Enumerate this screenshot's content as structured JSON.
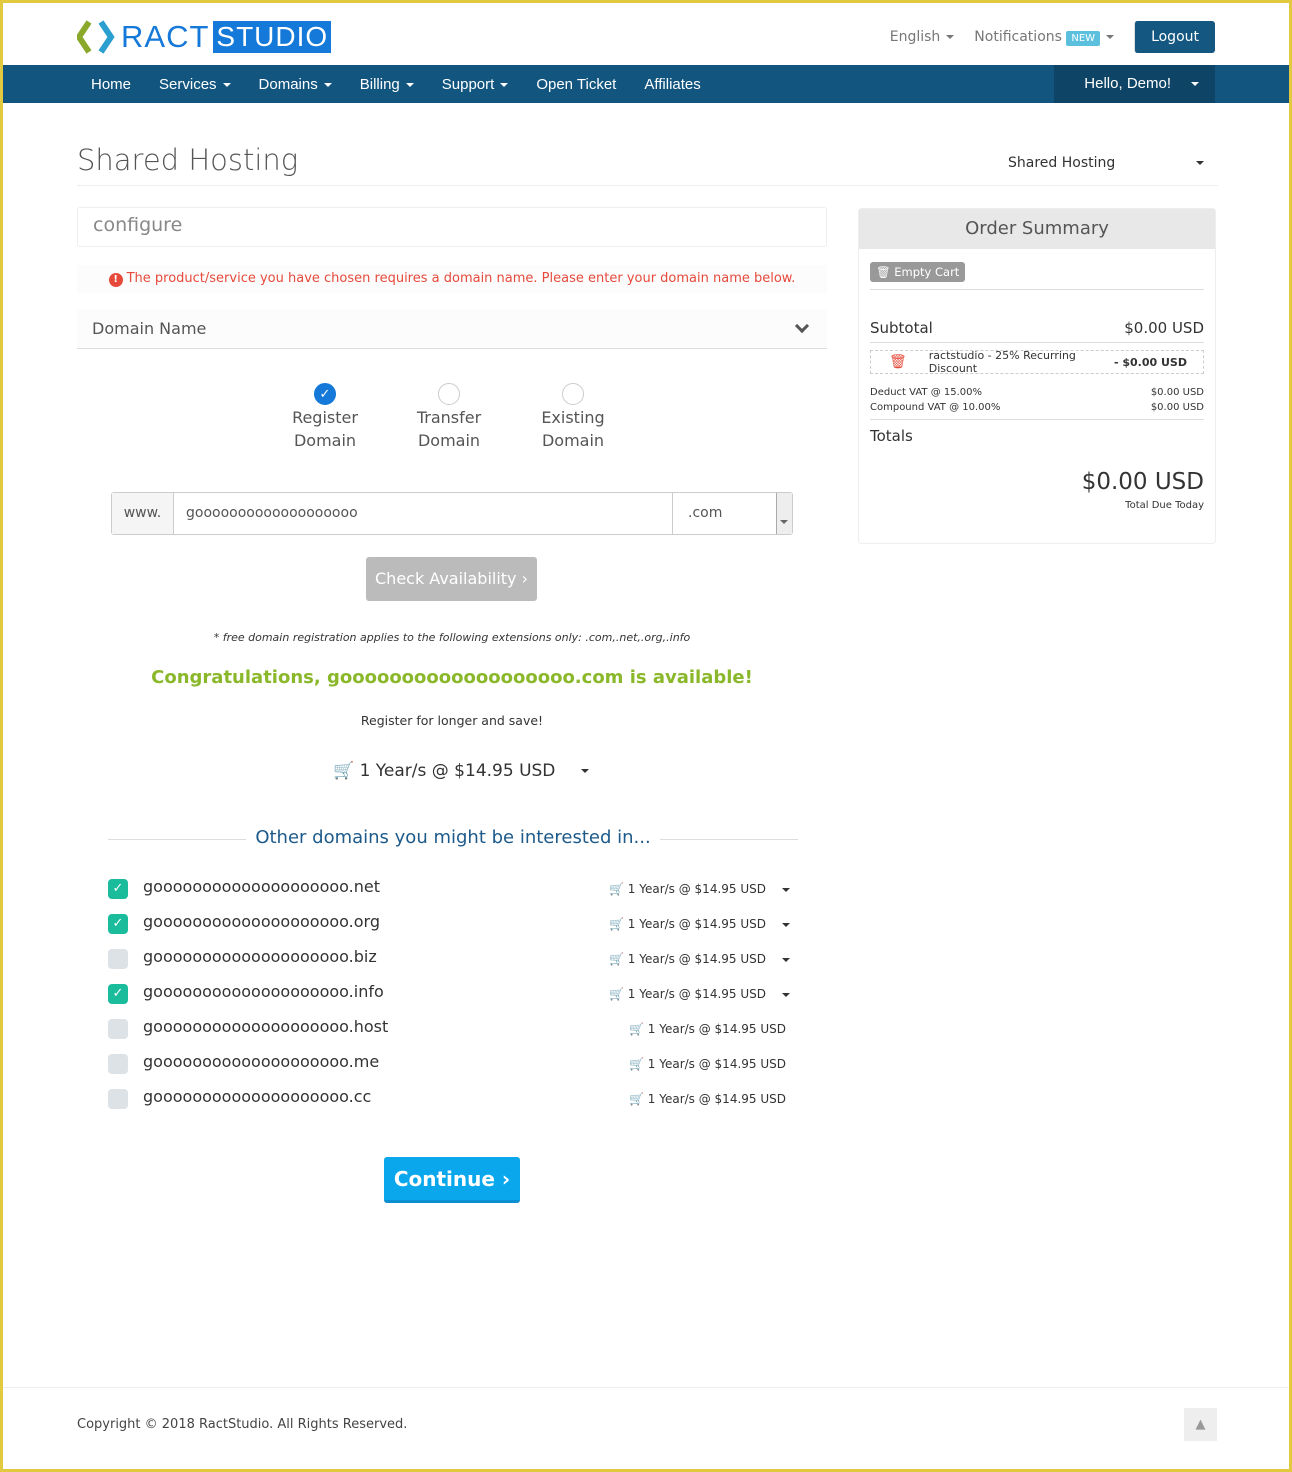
{
  "brand": {
    "part1": "RACT",
    "part2": "STUDIO",
    "accent": "#1479d8"
  },
  "topbar": {
    "language": "English",
    "notifications": "Notifications",
    "new_badge": "NEW",
    "logout": "Logout"
  },
  "nav": {
    "items": [
      "Home",
      "Services",
      "Domains",
      "Billing",
      "Support",
      "Open Ticket",
      "Affiliates"
    ],
    "user": "Hello, Demo!"
  },
  "page": {
    "title": "Shared Hosting",
    "category_select": "Shared Hosting"
  },
  "configure": {
    "heading": "configure",
    "alert": "The product/service you have chosen requires a domain name. Please enter your domain name below.",
    "domain_name_label": "Domain Name",
    "options": [
      {
        "label1": "Register",
        "label2": "Domain",
        "selected": true
      },
      {
        "label1": "Transfer",
        "label2": "Domain",
        "selected": false
      },
      {
        "label1": "Existing",
        "label2": "Domain",
        "selected": false
      }
    ],
    "www": "www.",
    "domain_input": "gooooooooooooooooooo",
    "tld": ".com",
    "check_button": "Check Availability",
    "free_note": "* free domain registration applies to the following extensions only: .com,.net,.org,.info",
    "available": "Congratulations, gooooooooooooooooooo.com is available!",
    "register_longer": "Register for longer and save!",
    "period": "1 Year/s @ $14.95 USD",
    "other_heading": "Other domains you might be interested in...",
    "suggestions": [
      {
        "name": "goooooooooooooooooooo.net",
        "price": "1 Year/s @ $14.95 USD",
        "checked": true,
        "dropdown": true
      },
      {
        "name": "goooooooooooooooooooo.org",
        "price": "1 Year/s @ $14.95 USD",
        "checked": true,
        "dropdown": true
      },
      {
        "name": "goooooooooooooooooooo.biz",
        "price": "1 Year/s @ $14.95 USD",
        "checked": false,
        "dropdown": true
      },
      {
        "name": "goooooooooooooooooooo.info",
        "price": "1 Year/s @ $14.95 USD",
        "checked": true,
        "dropdown": true
      },
      {
        "name": "goooooooooooooooooooo.host",
        "price": "1 Year/s @ $14.95 USD",
        "checked": false,
        "dropdown": false
      },
      {
        "name": "goooooooooooooooooooo.me",
        "price": "1 Year/s @ $14.95 USD",
        "checked": false,
        "dropdown": false
      },
      {
        "name": "goooooooooooooooooooo.cc",
        "price": "1 Year/s @ $14.95 USD",
        "checked": false,
        "dropdown": false
      }
    ],
    "continue": "Continue"
  },
  "summary": {
    "heading": "Order Summary",
    "empty_cart": "Empty Cart",
    "subtotal_label": "Subtotal",
    "subtotal": "$0.00 USD",
    "discount_label": "ractstudio - 25% Recurring Discount",
    "discount": "- $0.00 USD",
    "tax1_label": "Deduct VAT @ 15.00%",
    "tax1": "$0.00 USD",
    "tax2_label": "Compound VAT @ 10.00%",
    "tax2": "$0.00 USD",
    "totals_label": "Totals",
    "total": "$0.00 USD",
    "total_due": "Total Due Today"
  },
  "footer": {
    "copyright": "Copyright © 2018 RactStudio. All Rights Reserved."
  }
}
